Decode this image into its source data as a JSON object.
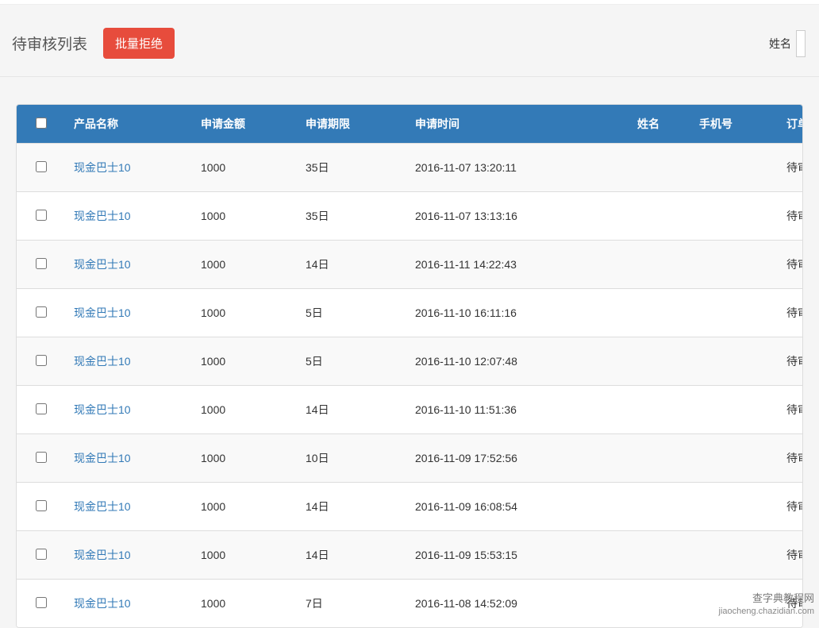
{
  "header": {
    "title": "待审核列表",
    "reject_button": "批量拒绝",
    "filter_label": "姓名"
  },
  "table": {
    "headers": {
      "product": "产品名称",
      "amount": "申请金额",
      "period": "申请期限",
      "time": "申请时间",
      "name": "姓名",
      "phone": "手机号",
      "status": "订单状"
    },
    "rows": [
      {
        "product": "现金巴士10",
        "amount": "1000",
        "period": "35日",
        "time": "2016-11-07 13:20:11",
        "name": "",
        "phone": "",
        "status": "待审核"
      },
      {
        "product": "现金巴士10",
        "amount": "1000",
        "period": "35日",
        "time": "2016-11-07 13:13:16",
        "name": "",
        "phone": "",
        "status": "待审核"
      },
      {
        "product": "现金巴士10",
        "amount": "1000",
        "period": "14日",
        "time": "2016-11-11 14:22:43",
        "name": "",
        "phone": "",
        "status": "待审核"
      },
      {
        "product": "现金巴士10",
        "amount": "1000",
        "period": "5日",
        "time": "2016-11-10 16:11:16",
        "name": "",
        "phone": "",
        "status": "待审核"
      },
      {
        "product": "现金巴士10",
        "amount": "1000",
        "period": "5日",
        "time": "2016-11-10 12:07:48",
        "name": "",
        "phone": "",
        "status": "待审核"
      },
      {
        "product": "现金巴士10",
        "amount": "1000",
        "period": "14日",
        "time": "2016-11-10 11:51:36",
        "name": "",
        "phone": "",
        "status": "待审核"
      },
      {
        "product": "现金巴士10",
        "amount": "1000",
        "period": "10日",
        "time": "2016-11-09 17:52:56",
        "name": "",
        "phone": "",
        "status": "待审核"
      },
      {
        "product": "现金巴士10",
        "amount": "1000",
        "period": "14日",
        "time": "2016-11-09 16:08:54",
        "name": "",
        "phone": "",
        "status": "待审核"
      },
      {
        "product": "现金巴士10",
        "amount": "1000",
        "period": "14日",
        "time": "2016-11-09 15:53:15",
        "name": "",
        "phone": "",
        "status": "待审核"
      },
      {
        "product": "现金巴士10",
        "amount": "1000",
        "period": "7日",
        "time": "2016-11-08 14:52:09",
        "name": "",
        "phone": "",
        "status": "待审核"
      }
    ]
  },
  "watermark": {
    "main": "查字典教程网",
    "sub": "jiaocheng.chazidian.com"
  }
}
